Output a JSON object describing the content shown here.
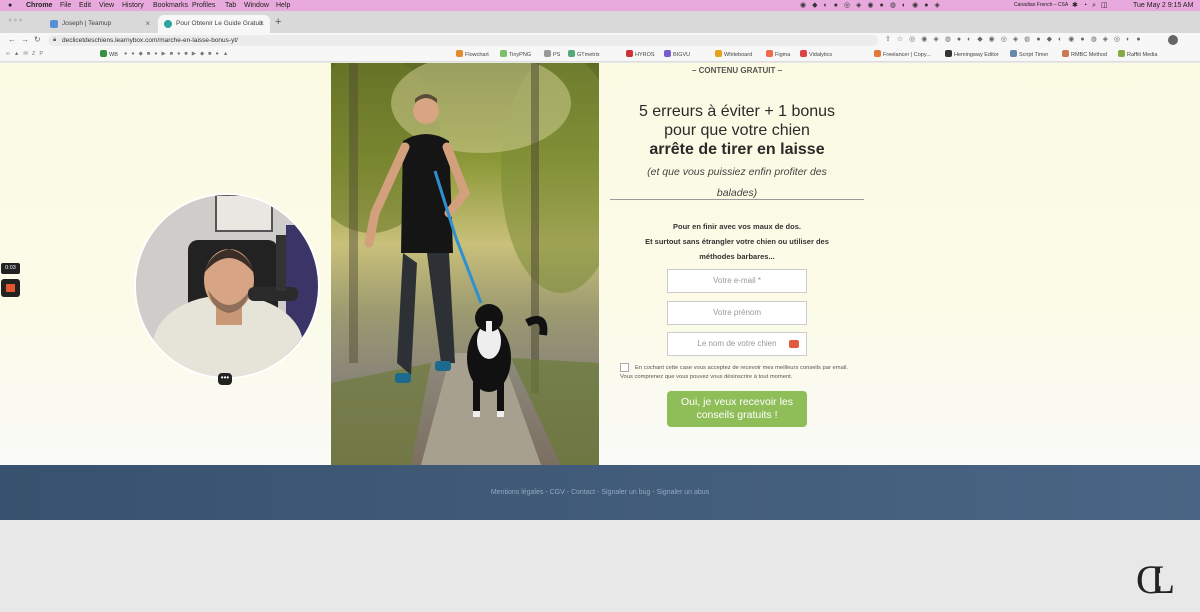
{
  "os_menu": {
    "app_name": "Chrome",
    "items": [
      "File",
      "Edit",
      "View",
      "History",
      "Bookmarks",
      "Profiles",
      "Tab",
      "Window",
      "Help"
    ],
    "input_source": "Canadian French – CSA",
    "clock": "Tue May 2  9:15 AM"
  },
  "tabs": [
    {
      "title": "Joseph | Teamup",
      "active": false
    },
    {
      "title": "Pour Obtenir Le Guide Gratuit",
      "active": true
    }
  ],
  "address": {
    "url": "declicetdeschiens.learnybox.com/marche-en-laisse-bonus-yt/"
  },
  "bookmarks": [
    "WB",
    "Flowchart",
    "TinyPNG",
    "PS",
    "GTmetrix",
    "HYROS",
    "BIGVU",
    "Whiteboard",
    "Figma",
    "Vidalytics",
    "Freelancer | Copy...",
    "Hemingway Editor",
    "Script Timer",
    "RMBC Method",
    "Raffiti Media"
  ],
  "content": {
    "eyebrow": "– CONTENU GRATUIT –",
    "headline_1": "5 erreurs à éviter + 1 bonus",
    "headline_2": "pour que votre chien",
    "headline_bold": "arrête de tirer en laisse",
    "headline_italic_1": "(et que vous puissiez enfin profiter des",
    "headline_italic_2": "balades)",
    "pitch_1": "Pour en finir avec vos maux de dos.",
    "pitch_2": "Et surtout sans  étrangler votre chien ou utiliser des",
    "pitch_3": "méthodes barbares..."
  },
  "form": {
    "email_placeholder": "Votre e-mail *",
    "firstname_placeholder": "Votre prénom",
    "dogname_placeholder": "Le nom de votre chien",
    "consent_line_1": "En cochant cette case vous acceptez de recevoir mes meilleurs conseils",
    "consent_line_2": "par email. Vous comprenez que vous pouvez vous désinscrire à tout moment.",
    "cta_line_1": "Oui, je veux recevoir les",
    "cta_line_2": "conseils gratuits !"
  },
  "footer": {
    "links": "Mentions légales - CGV - Contact - Signaler un bug - Signaler un abus"
  },
  "recorder": {
    "timer": "0:03"
  },
  "watermark": "CL",
  "colors": {
    "cta": "#8fbe58",
    "footer": "#3f5a78",
    "menubar": "#e8a9dc"
  }
}
